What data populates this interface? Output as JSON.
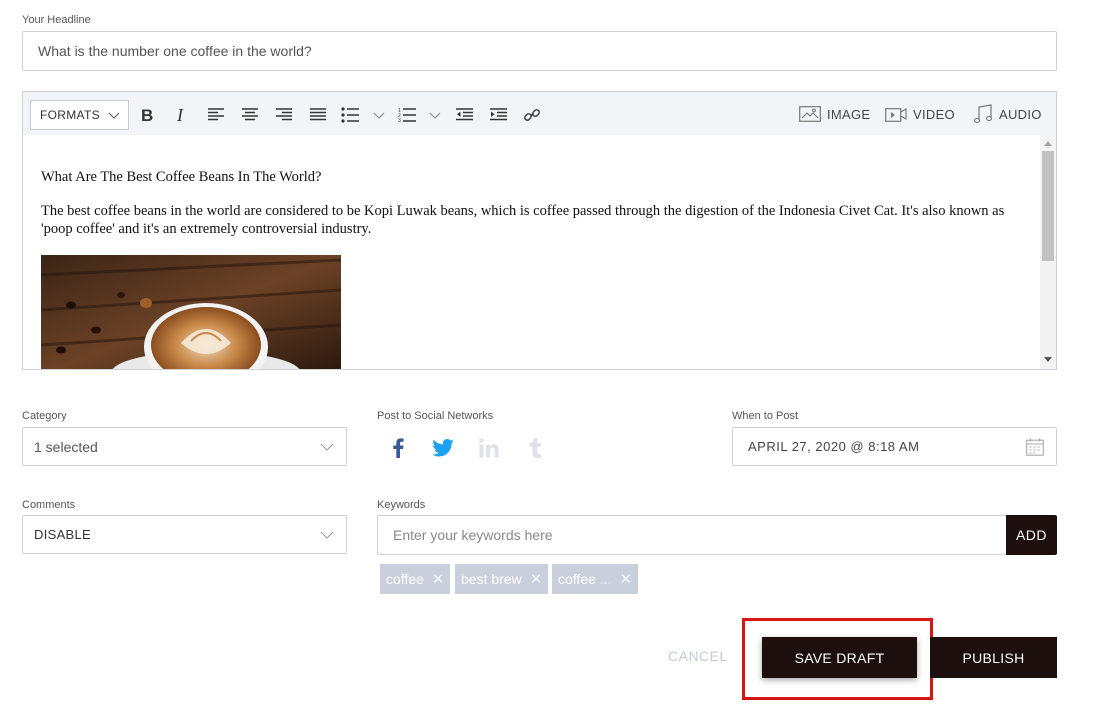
{
  "headline": {
    "label": "Your Headline",
    "value": "What is the number one coffee in the world?"
  },
  "editor": {
    "toolbar": {
      "formats_label": "FORMATS",
      "image_label": "IMAGE",
      "video_label": "VIDEO",
      "audio_label": "AUDIO",
      "icons": [
        "bold-icon",
        "italic-icon",
        "align-left-icon",
        "align-center-icon",
        "align-right-icon",
        "align-justify-icon",
        "bullet-list-icon",
        "numbered-list-icon",
        "outdent-icon",
        "indent-icon",
        "link-icon"
      ]
    },
    "content": {
      "heading": "What Are The Best Coffee Beans In The World?",
      "paragraph": "The best coffee beans in the world are considered to be Kopi Luwak beans, which is coffee passed through the digestion of the Indonesia Civet Cat. It's also known as 'poop coffee' and it's an extremely controversial industry."
    }
  },
  "category": {
    "label": "Category",
    "value": "1 selected"
  },
  "social": {
    "label": "Post to Social Networks",
    "networks": [
      {
        "name": "facebook-icon",
        "color": "#3b5998",
        "active": true
      },
      {
        "name": "twitter-icon",
        "color": "#1da1f2",
        "active": true
      },
      {
        "name": "linkedin-icon",
        "color": "#dfe3e8",
        "active": false
      },
      {
        "name": "tumblr-icon",
        "color": "#dfe3e8",
        "active": false
      }
    ]
  },
  "when": {
    "label": "When to Post",
    "value": "APRIL 27, 2020 @ 8:18 AM"
  },
  "comments": {
    "label": "Comments",
    "value": "DISABLE"
  },
  "keywords": {
    "label": "Keywords",
    "placeholder": "Enter your keywords here",
    "add_label": "ADD",
    "tags": [
      "coffee",
      "best brew",
      "coffee ..."
    ]
  },
  "actions": {
    "cancel_label": "CANCEL",
    "save_draft_label": "SAVE DRAFT",
    "publish_label": "PUBLISH"
  },
  "colors": {
    "button_dark": "#1c0f0d",
    "highlight": "#d81414",
    "tag_bg": "#c9d0db"
  }
}
